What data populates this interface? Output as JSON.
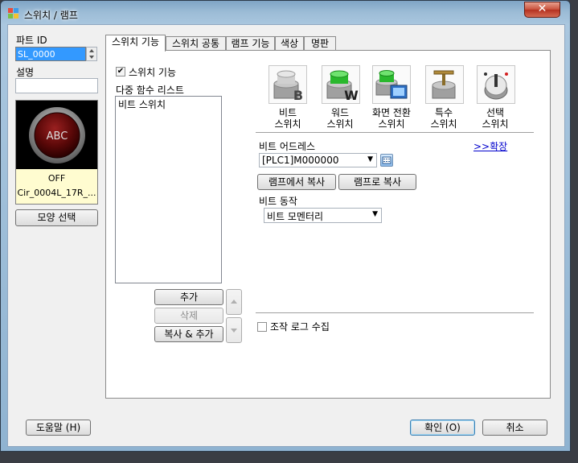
{
  "window": {
    "title": "스위치 /  램프",
    "close_glyph": "✕"
  },
  "left": {
    "parts_id_label": "파트 ID",
    "parts_id_value": "SL_0000",
    "desc_label": "설명",
    "desc_value": "",
    "preview_text": "ABC",
    "state": "OFF",
    "shape_name": "Cir_0004L_17R_...",
    "shape_button": "모양 선택"
  },
  "tabs": [
    {
      "label": "스위치 기능",
      "active": true
    },
    {
      "label": "스위치 공통",
      "active": false
    },
    {
      "label": "램프 기능",
      "active": false
    },
    {
      "label": "색상",
      "active": false
    },
    {
      "label": "명판",
      "active": false
    }
  ],
  "panel": {
    "switch_func_checkbox": "스위치 기능",
    "switch_func_checked": true,
    "multi_func_label": "다중 함수 리스트",
    "list_items": [
      "비트 스위치"
    ],
    "btn_add": "추가",
    "btn_delete": "삭제",
    "btn_copy_add": "복사 & 추가",
    "switch_types": [
      {
        "line1": "비트",
        "line2": "스위치",
        "icon": "bit-switch-icon"
      },
      {
        "line1": "워드",
        "line2": "스위치",
        "icon": "word-switch-icon"
      },
      {
        "line1": "화면 전환",
        "line2": "스위치",
        "icon": "screen-change-switch-icon"
      },
      {
        "line1": "특수",
        "line2": "스위치",
        "icon": "special-switch-icon"
      },
      {
        "line1": "선택",
        "line2": "스위치",
        "icon": "selector-switch-icon"
      }
    ],
    "bit_address_label": "비트 어드레스",
    "expand_link": ">>확장",
    "bit_address_value": "[PLC1]M000000",
    "copy_from_lamp": "램프에서 복사",
    "copy_to_lamp": "램프로 복사",
    "bit_action_label": "비트 동작",
    "bit_action_value": "비트 모멘터리",
    "op_log_checkbox": "조작 로그 수집",
    "op_log_checked": false
  },
  "footer": {
    "help": "도움말 (H)",
    "ok": "확인 (O)",
    "cancel": "취소"
  },
  "colors": {
    "accent": "#3c7fb1",
    "link": "#0000cc",
    "preview_bg": "#000000",
    "state_bg": "#fffcd0"
  }
}
